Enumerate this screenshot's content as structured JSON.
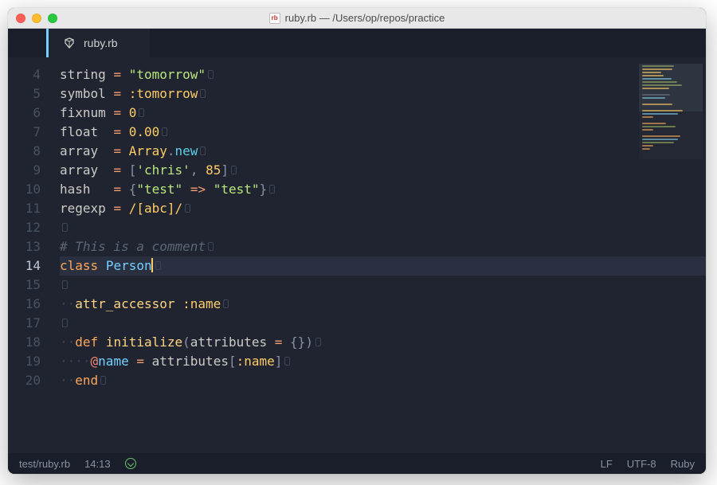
{
  "window": {
    "title_file": "ruby.rb",
    "title_sep": " — ",
    "title_path": "/Users/op/repos/practice"
  },
  "tab": {
    "label": "ruby.rb"
  },
  "gutter": {
    "start": 4,
    "end": 20,
    "current": 14
  },
  "code": {
    "l4": {
      "var": "string",
      "op": "=",
      "q1": "\"",
      "str": "tomorrow",
      "q2": "\""
    },
    "l5": {
      "var": "symbol",
      "op": "=",
      "sym": ":tomorrow"
    },
    "l6": {
      "var": "fixnum",
      "op": "=",
      "num": "0"
    },
    "l7": {
      "var": "float",
      "op": "=",
      "num": "0.00"
    },
    "l8": {
      "var": "array",
      "op": "=",
      "const": "Array",
      "dot": ".",
      "call": "new"
    },
    "l9": {
      "var": "array",
      "op": "=",
      "lb": "[",
      "q1": "'",
      "str": "chris",
      "q2": "'",
      "comma": ",",
      "num": "85",
      "rb": "]"
    },
    "l10": {
      "var": "hash",
      "op": "=",
      "lb": "{",
      "q1": "\"",
      "k": "test",
      "q2": "\"",
      "rocket": "=>",
      "q3": "\"",
      "v": "test",
      "q4": "\"",
      "rb": "}"
    },
    "l11": {
      "var": "regexp",
      "op": "=",
      "s1": "/",
      "body": "[abc]",
      "s2": "/"
    },
    "l13": {
      "cmt": "# This is a comment"
    },
    "l14": {
      "kw": "class",
      "cls": "Person"
    },
    "l16": {
      "attr": "attr_accessor",
      "sym": ":name"
    },
    "l18": {
      "kw": "def",
      "mname": "initialize",
      "lp": "(",
      "p": "attributes",
      "eq": "=",
      "lb": "{",
      "rb": "}",
      "rp": ")"
    },
    "l19": {
      "at": "@",
      "ivar": "name",
      "eq": "=",
      "rec": "attributes",
      "lb": "[",
      "sym": ":name",
      "rb": "]"
    },
    "l20": {
      "kw": "end"
    }
  },
  "status": {
    "path": "test/ruby.rb",
    "pos": "14:13",
    "eol": "LF",
    "encoding": "UTF-8",
    "lang": "Ruby"
  }
}
